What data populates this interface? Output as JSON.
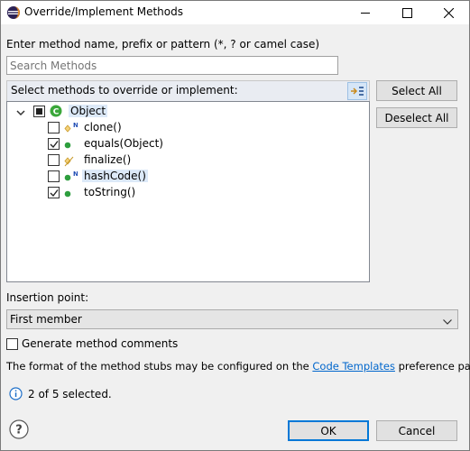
{
  "window": {
    "title": "Override/Implement Methods",
    "minimize_label": "minimize",
    "maximize_label": "maximize",
    "close_label": "close"
  },
  "search": {
    "prompt": "Enter method name, prefix or pattern (*, ? or camel case)",
    "placeholder": "Search Methods"
  },
  "tree": {
    "header": "Select methods to override or implement:",
    "root": {
      "label": "Object",
      "state": "mixed"
    },
    "methods": [
      {
        "label": "clone()",
        "checked": false,
        "icon": "protected-method-icon",
        "native": true
      },
      {
        "label": "equals(Object)",
        "checked": true,
        "icon": "public-method-icon",
        "native": false
      },
      {
        "label": "finalize()",
        "checked": false,
        "icon": "deprecated-protected-method-icon",
        "native": false
      },
      {
        "label": "hashCode()",
        "checked": false,
        "icon": "public-method-icon",
        "native": true
      },
      {
        "label": "toString()",
        "checked": true,
        "icon": "public-method-icon",
        "native": false
      }
    ],
    "native_marker": "N"
  },
  "buttons": {
    "select_all": "Select All",
    "deselect_all": "Deselect All",
    "ok": "OK",
    "cancel": "Cancel"
  },
  "insertion": {
    "label": "Insertion point:",
    "value": "First member"
  },
  "generate_comments": {
    "label": "Generate method comments",
    "checked": false
  },
  "footer": {
    "text_before": "The format of the method stubs may be configured on the",
    "link": "Code Templates",
    "text_after": "preference page.",
    "status": "2 of 5 selected."
  },
  "colors": {
    "accent": "#0078d7",
    "public_method": "#2e9e3e",
    "protected_method": "#e8b84a",
    "link": "#0066cc",
    "class_icon": "#3aa73a"
  }
}
